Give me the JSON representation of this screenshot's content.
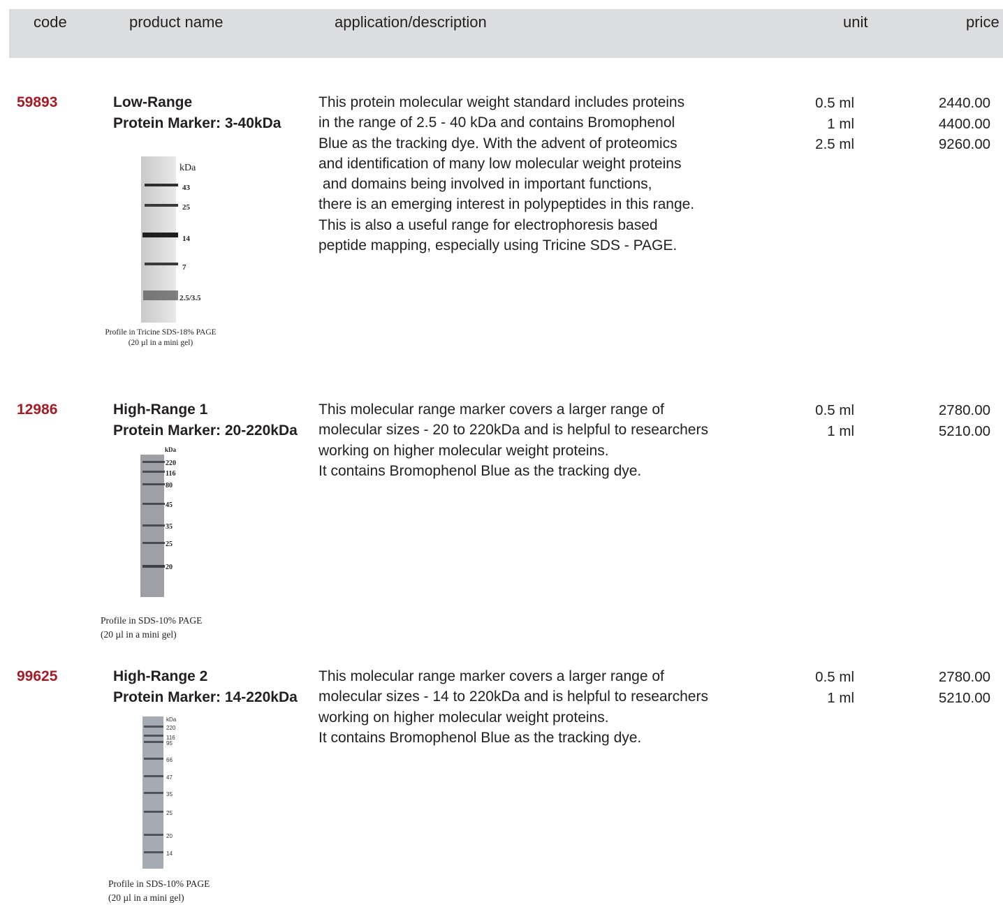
{
  "header": {
    "code": "code",
    "product_name": "product name",
    "description": "application/description",
    "unit": "unit",
    "price": "price"
  },
  "products": [
    {
      "code": "59893",
      "name_line1": "Low-Range",
      "name_line2": "Protein Marker: 3-40kDa",
      "description": [
        "This  protein molecular weight standard includes proteins",
        "in the range of 2.5 - 40 kDa and contains Bromophenol",
        "Blue as the tracking dye. With the advent of proteomics",
        "and identification of many low molecular weight proteins",
        " and domains being involved in important functions,",
        "there is an emerging interest in polypeptides in this range.",
        "This is also a useful range for electrophoresis based",
        "peptide mapping, especially using Tricine SDS - PAGE."
      ],
      "units": [
        "0.5 ml",
        "1 ml",
        "2.5 ml"
      ],
      "prices": [
        "2440.00",
        "4400.00",
        "9260.00"
      ],
      "gel": {
        "unit_label": "kDa",
        "bands": [
          "43",
          "25",
          "14",
          "7",
          "2.5/3.5"
        ],
        "caption_line1": "Profile in Tricine SDS-18% PAGE",
        "caption_line2": "(20 µl in a mini gel)"
      }
    },
    {
      "code": "12986",
      "name_line1": "High-Range 1",
      "name_line2": "Protein Marker: 20-220kDa",
      "description": [
        "This molecular range marker covers a larger range of",
        "molecular sizes - 20 to 220kDa and is helpful to researchers",
        "working on higher molecular weight proteins.",
        "It contains Bromophenol Blue as the tracking dye."
      ],
      "units": [
        "0.5 ml",
        "1 ml"
      ],
      "prices": [
        "2780.00",
        "5210.00"
      ],
      "gel": {
        "unit_label": "kDa",
        "bands": [
          "220",
          "116",
          "80",
          "45",
          "35",
          "25",
          "20"
        ],
        "caption_line1": "Profile in SDS-10% PAGE",
        "caption_line2": "(20 µl in a mini gel)"
      }
    },
    {
      "code": "99625",
      "name_line1": "High-Range 2",
      "name_line2": "Protein Marker: 14-220kDa",
      "description": [
        "This molecular range marker covers a larger range of",
        "molecular sizes - 14 to 220kDa and is helpful to researchers",
        "working on higher molecular weight proteins.",
        "It contains Bromophenol Blue as the tracking dye."
      ],
      "units": [
        "0.5 ml",
        "1 ml"
      ],
      "prices": [
        "2780.00",
        "5210.00"
      ],
      "gel": {
        "unit_label": "kDa",
        "bands": [
          "220",
          "116",
          "95",
          "66",
          "47",
          "35",
          "25",
          "20",
          "14"
        ],
        "caption_line1": "Profile in SDS-10% PAGE",
        "caption_line2": "(20 µl in a mini gel)"
      }
    }
  ],
  "colors": {
    "header_bg": "#dcdddf",
    "code_red": "#a31d24",
    "text": "#231f20"
  }
}
